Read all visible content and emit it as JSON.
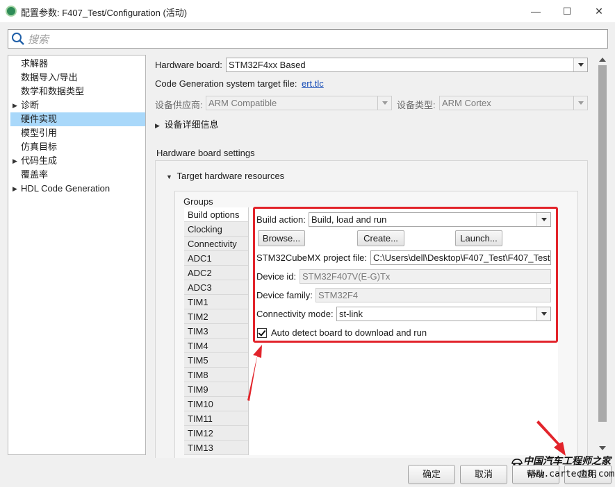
{
  "window": {
    "title": "配置参数: F407_Test/Configuration (活动)",
    "minimize": "—",
    "maximize": "☐",
    "close": "✕"
  },
  "search": {
    "placeholder": "搜索"
  },
  "tree": {
    "items": [
      {
        "label": "求解器"
      },
      {
        "label": "数据导入/导出"
      },
      {
        "label": "数学和数据类型"
      },
      {
        "label": "诊断"
      },
      {
        "label": "硬件实现"
      },
      {
        "label": "模型引用"
      },
      {
        "label": "仿真目标"
      },
      {
        "label": "代码生成"
      },
      {
        "label": "覆盖率"
      },
      {
        "label": "HDL Code Generation"
      }
    ],
    "selected_index": 4
  },
  "hardware": {
    "board_label": "Hardware board:",
    "board_value": "STM32F4xx Based",
    "codegen_label": "Code Generation system target file:",
    "codegen_link": "ert.tlc",
    "vendor_label": "设备供应商:",
    "vendor_value": "ARM Compatible",
    "type_label": "设备类型:",
    "type_value": "ARM Cortex",
    "details_label": "设备详细信息",
    "settings_heading": "Hardware board settings",
    "target_resources": "Target hardware resources",
    "groups_label": "Groups"
  },
  "groups": [
    "Build options",
    "Clocking",
    "Connectivity",
    "ADC1",
    "ADC2",
    "ADC3",
    "TIM1",
    "TIM2",
    "TIM3",
    "TIM4",
    "TIM5",
    "TIM8",
    "TIM9",
    "TIM10",
    "TIM11",
    "TIM12",
    "TIM13"
  ],
  "build": {
    "action_label": "Build action:",
    "action_value": "Build, load and run",
    "browse": "Browse...",
    "create": "Create...",
    "launch": "Launch...",
    "cubemx_label": "STM32CubeMX project file:",
    "cubemx_value": "C:\\Users\\dell\\Desktop\\F407_Test\\F407_Test",
    "device_id_label": "Device id:",
    "device_id_value": "STM32F407V(E-G)Tx",
    "device_family_label": "Device family:",
    "device_family_value": "STM32F4",
    "conn_label": "Connectivity mode:",
    "conn_value": "st-link",
    "auto_detect_label": "Auto detect board to download and run",
    "auto_detect_checked": true
  },
  "footer": {
    "ok": "确定",
    "cancel": "取消",
    "help": "帮助",
    "apply": "应用"
  },
  "watermark": {
    "line1": "中国汽车工程师之家",
    "line2": "www.cartech8.com"
  },
  "colors": {
    "selection": "#a9d8fa",
    "highlight_red": "#e2242b",
    "link": "#1a4fb8"
  }
}
